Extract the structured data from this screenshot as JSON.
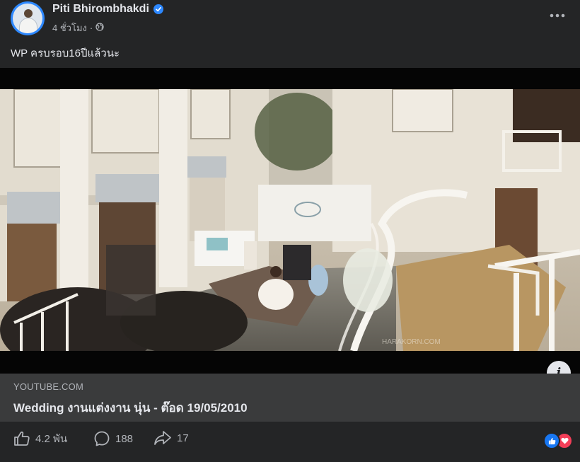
{
  "post": {
    "author": "Piti Bhirombhakdi",
    "time": "4 ชั่วโมง",
    "separator": "·",
    "text": "WP ครบรอบ16ปีแล้วนะ"
  },
  "link_preview": {
    "domain": "YOUTUBE.COM",
    "title": "Wedding งานแต่งงาน นุ่น - ต๊อด 19/05/2010",
    "watermark": "HARAKORN.COM"
  },
  "engagement": {
    "likes": "4.2 พัน",
    "comments": "188",
    "shares": "17"
  },
  "icons": {
    "verified": "verified-badge-icon",
    "audience": "globe-icon",
    "more": "more-options-icon",
    "info": "info-icon",
    "like": "thumbs-up-icon",
    "comment": "comment-icon",
    "share": "share-icon",
    "reactions": [
      "like-reaction-icon",
      "love-reaction-icon"
    ]
  },
  "colors": {
    "background": "#242526",
    "link_box": "#3a3b3c",
    "text_primary": "#e4e6eb",
    "text_secondary": "#b0b3b8",
    "accent_blue": "#2d88ff",
    "love_red": "#f33e58"
  }
}
